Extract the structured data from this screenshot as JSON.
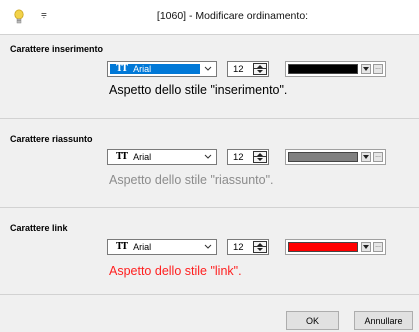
{
  "window": {
    "title": "[1060] - Modificare ordinamento:",
    "quick_access": "⩦"
  },
  "sections": [
    {
      "title": "Carattere inserimento",
      "font": "Arial",
      "font_selected": true,
      "size": "12",
      "color": "#000000",
      "preview_text": "Aspetto dello stile \"inserimento\".",
      "preview_color": "#000000"
    },
    {
      "title": "Carattere riassunto",
      "font": "Arial",
      "font_selected": false,
      "size": "12",
      "color": "#808080",
      "preview_text": "Aspetto dello stile \"riassunto\".",
      "preview_color": "#8c8c8c"
    },
    {
      "title": "Carattere link",
      "font": "Arial",
      "font_selected": false,
      "size": "12",
      "color": "#ff0000",
      "preview_text": "Aspetto dello stile \"link\".",
      "preview_color": "#ff2020"
    }
  ],
  "icons": {
    "lightbulb": "lightbulb-icon",
    "truetype": "truetype-font-icon",
    "chevron": "chevron-down-icon",
    "spin_up": "spin-up-icon",
    "spin_down": "spin-down-icon",
    "more": "ellipsis-icon"
  },
  "colors": {
    "selection": "#0078d7",
    "background": "#f0f0f0"
  },
  "buttons": {
    "ok": "OK",
    "cancel": "Annullare"
  }
}
